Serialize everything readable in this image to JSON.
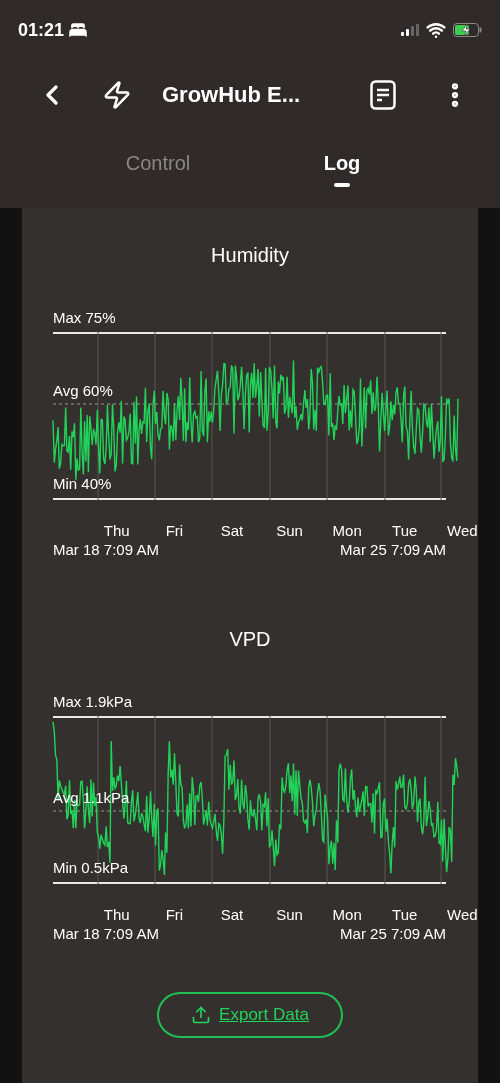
{
  "status_bar": {
    "time": "01:21"
  },
  "header": {
    "title": "GrowHub E..."
  },
  "tabs": [
    {
      "label": "Control",
      "selected": false
    },
    {
      "label": "Log",
      "selected": true
    }
  ],
  "charts": [
    {
      "title": "Humidity",
      "max": "Max 75%",
      "avg": "Avg 60%",
      "min": "Min 40%",
      "days": [
        "Thu",
        "Fri",
        "Sat",
        "Sun",
        "Mon",
        "Tue",
        "Wed"
      ],
      "start": "Mar 18 7:09 AM",
      "end": "Mar 25 7:09 AM"
    },
    {
      "title": "VPD",
      "max": "Max 1.9kPa",
      "avg": "Avg 1.1kPa",
      "min": "Min 0.5kPa",
      "days": [
        "Thu",
        "Fri",
        "Sat",
        "Sun",
        "Mon",
        "Tue",
        "Wed"
      ],
      "start": "Mar 18 7:09 AM",
      "end": "Mar 25 7:09 AM"
    }
  ],
  "export_button": {
    "label": "Export Data"
  }
}
